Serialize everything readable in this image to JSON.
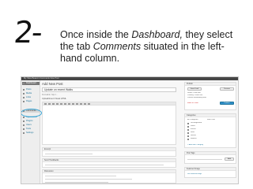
{
  "slide": {
    "step_number": "2-",
    "instruction_prefix": "Once inside the ",
    "instruction_em_1": "Dashboard,",
    "instruction_mid": " they select the tab ",
    "instruction_em_2": "Comments",
    "instruction_suffix": " situated in the left-hand column."
  },
  "screenshot": {
    "admin_bar_text": "My Sites   Beacon  Comments  New Post",
    "sidebar_items": [
      {
        "label": "Dashboard",
        "style": "header"
      },
      {
        "label": "Posts",
        "style": "normal"
      },
      {
        "label": "Media",
        "style": "normal"
      },
      {
        "label": "Links",
        "style": "normal"
      },
      {
        "label": "Pages",
        "style": "normal"
      },
      {
        "label": "Comments",
        "style": "active"
      },
      {
        "label": "Appearance",
        "style": "normal"
      },
      {
        "label": "Plugins",
        "style": "normal"
      },
      {
        "label": "Users",
        "style": "normal"
      },
      {
        "label": "Tools",
        "style": "normal"
      },
      {
        "label": "Settings",
        "style": "normal"
      }
    ],
    "page_title": "Add New Post",
    "post_title_value": "Update on recent Walks",
    "permalink": "Permalink: http://...",
    "editor_header": "Upload/Insert   Visual  HTML",
    "boxes": {
      "excerpt": "Excerpt",
      "send_trackbacks": "Send Trackbacks",
      "discussion": "Discussion"
    },
    "right": {
      "publish_title": "Publish",
      "save_draft": "Save Draft",
      "preview": "Preview",
      "status": "Status: Draft  Edit",
      "visibility": "Visibility: Public  Edit",
      "publish_immediately": "Publish immediately  Edit",
      "move_to_trash": "Move to Trash",
      "publish_button": "Publish",
      "categories_title": "Categories",
      "all_categories": "All Categories",
      "most_used": "Most Used",
      "category_items": [
        "Uncategorized",
        "Walks",
        "Events",
        "News",
        "Notices",
        "Reports"
      ],
      "add_category": "+ Add New Category",
      "tags_title": "Post Tags",
      "add_button": "Add",
      "featured_title": "Featured Image",
      "set_featured": "Set featured image"
    }
  }
}
